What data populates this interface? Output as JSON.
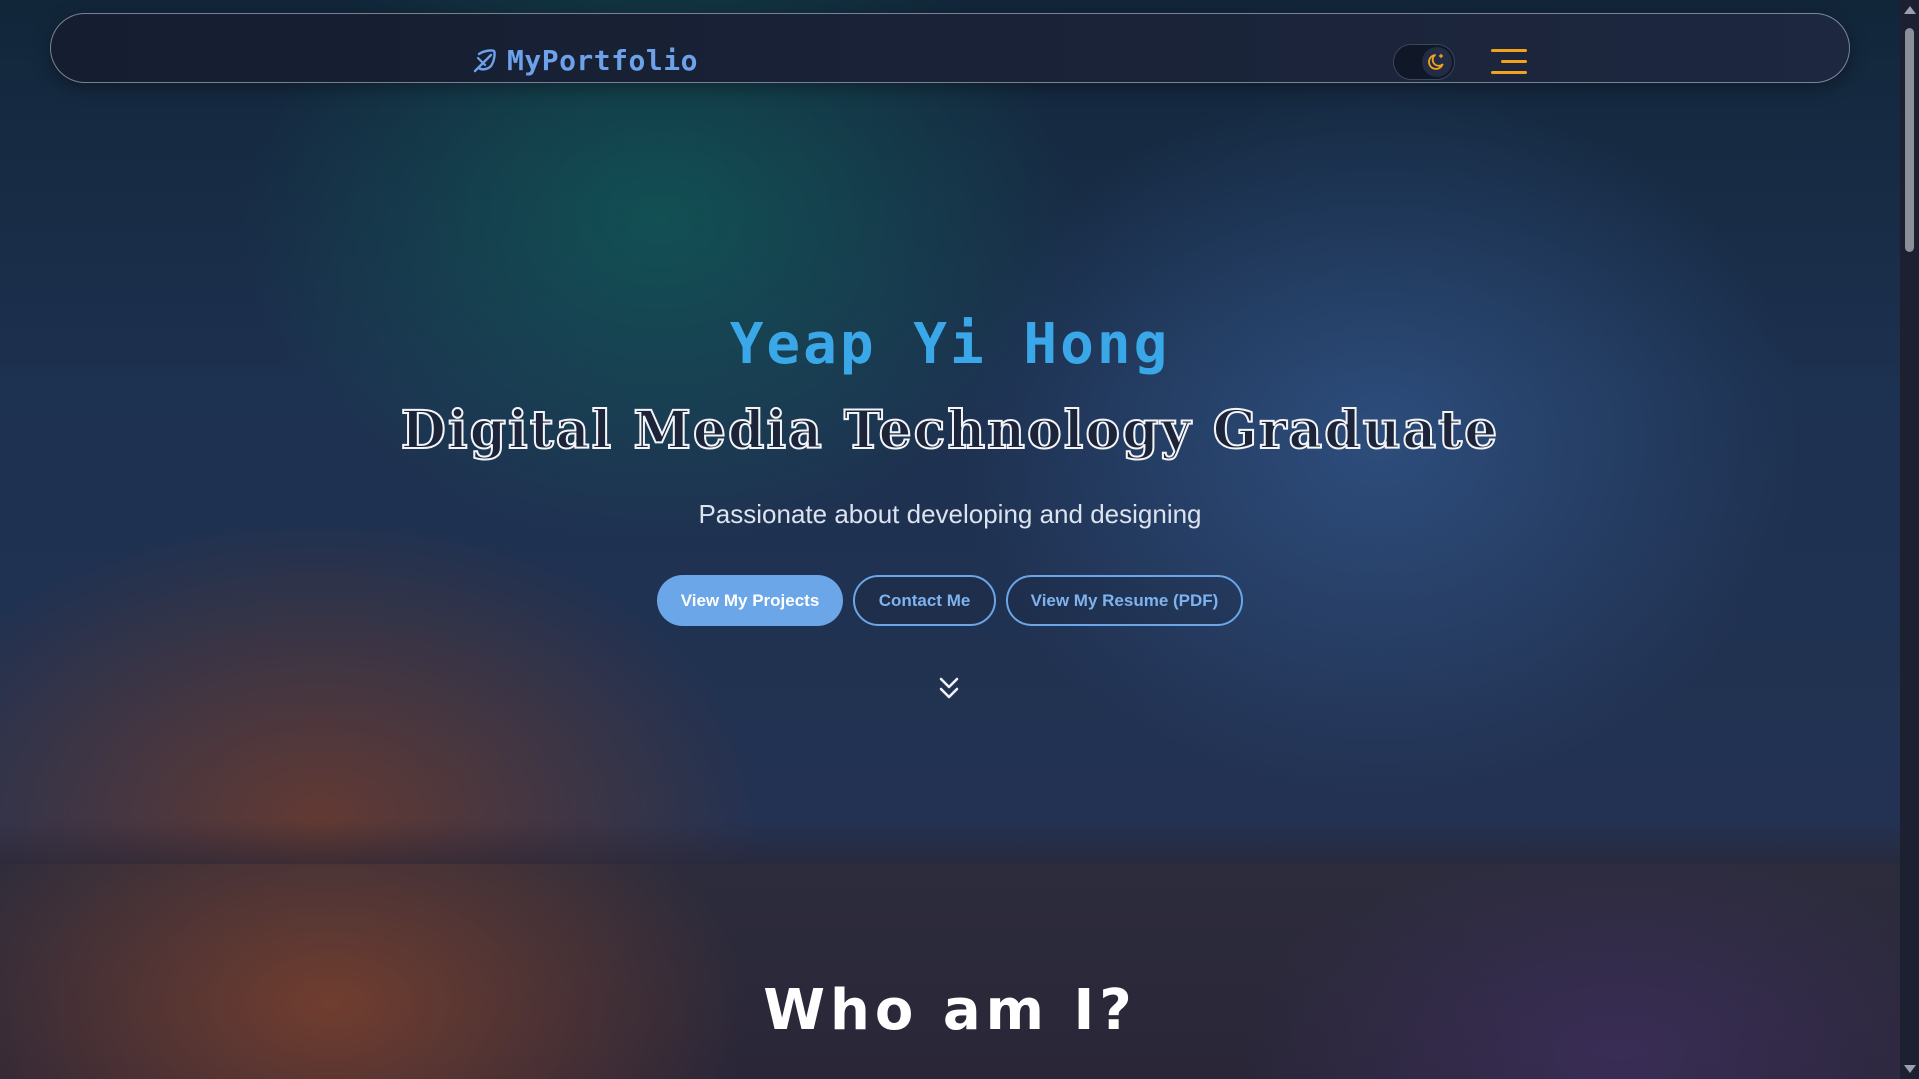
{
  "navbar": {
    "logo_text": "MyPortfolio",
    "logo_icon": "feather-icon",
    "theme_toggle_icon": "moon-icon",
    "menu_icon": "hamburger-menu-icon"
  },
  "hero": {
    "name": "Yeap Yi Hong",
    "title": "Digital Media Technology Graduate",
    "subtitle": "Passionate about developing and designing",
    "buttons": {
      "projects": "View My Projects",
      "contact": "Contact Me",
      "resume": "View My Resume (PDF)"
    },
    "scroll_icon": "double-chevron-down-icon"
  },
  "about": {
    "title": "Who am I?"
  },
  "colors": {
    "accent_blue": "#6aa6e8",
    "name_blue": "#3aa8e8",
    "menu_orange": "#f2a21e"
  }
}
